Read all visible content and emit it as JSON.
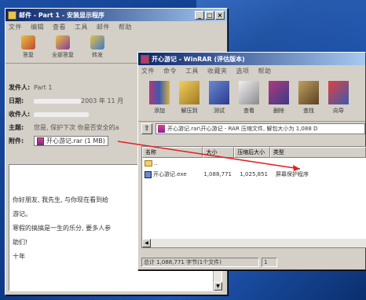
{
  "mail": {
    "title": "邮件 - Part 1 - 安装显示程序",
    "menu": [
      "文件",
      "编辑",
      "查看",
      "工具",
      "邮件",
      "帮助"
    ],
    "toolbar": [
      {
        "label": "答复",
        "icon": "reply-icon",
        "color": "#c04830"
      },
      {
        "label": "全部答复",
        "icon": "reply-all-icon",
        "color": "#8a3a9a"
      },
      {
        "label": "转发",
        "icon": "forward-icon",
        "color": "#3a7ad0"
      }
    ],
    "headers": {
      "from_label": "发件人:",
      "from_value": "Part 1",
      "date_label": "日期:",
      "date_value": "2003 年 11 月",
      "to_label": "收件人:",
      "subject_label": "主题:",
      "subject_value": "您是, 保护下次 你是否安全的a",
      "attach_label": "附件:",
      "attach_value": "开心游记.rar (1 MB)"
    },
    "body": [
      "你好朋友, 我先生, 与你现在看到给",
      "游记。",
      "寒假的搞搞是一生的乐分, 要多人参",
      "助们!",
      "十年"
    ]
  },
  "rar": {
    "title": "开心游记 - WinRAR (评估版本)",
    "menu": [
      "文件",
      "命令",
      "工具",
      "收藏夹",
      "选项",
      "帮助"
    ],
    "toolbar": [
      {
        "label": "添加",
        "icon": "books-add-icon",
        "color": "#b03a7a"
      },
      {
        "label": "解压到",
        "icon": "extract-icon",
        "color": "#d8b040"
      },
      {
        "label": "测试",
        "icon": "test-icon",
        "color": "#3a5ab0"
      },
      {
        "label": "查看",
        "icon": "view-icon",
        "color": "#6a6a6a"
      },
      {
        "label": "删除",
        "icon": "delete-icon",
        "color": "#8a6a3a"
      },
      {
        "label": "查找",
        "icon": "find-icon",
        "color": "#5a7a5a"
      },
      {
        "label": "向导",
        "icon": "wizard-icon",
        "color": "#a03030"
      }
    ],
    "path": "开心游记.rar\\开心游记 - RAR 压缩文件, 解包大小为 1,088 D",
    "columns": [
      "名称",
      "大小",
      "压缩后大小",
      "类型"
    ],
    "rows": [
      {
        "name": "..",
        "size": "",
        "packed": "",
        "type": "",
        "icon": "folder-up-icon"
      },
      {
        "name": "开心游记.exe",
        "size": "1,088,771",
        "packed": "1,025,851",
        "type": "屏幕保护程序",
        "icon": "exe-icon"
      }
    ],
    "status": [
      "总计 1,088,771 字节(1个文件)",
      "1"
    ]
  },
  "colors": {
    "desktop": "#123e8c",
    "titlebar_start": "#0a246a",
    "titlebar_end": "#a6caf0",
    "arrow": "#e02020"
  }
}
